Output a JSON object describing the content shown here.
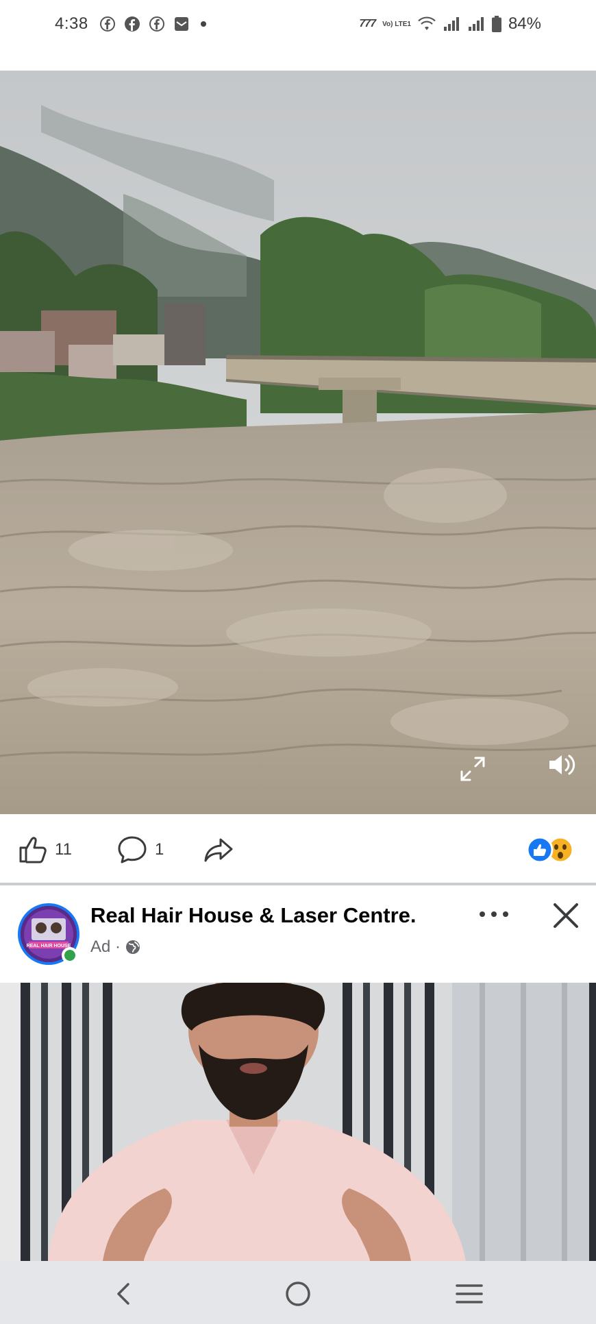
{
  "status_bar": {
    "time": "4:38",
    "network_label": "777",
    "volte_label": "Vo) LTE1",
    "battery": "84%"
  },
  "video": {
    "description_icon_expand": "expand-icon",
    "description_icon_sound": "speaker-icon"
  },
  "actions": {
    "like_count": "11",
    "comment_count": "1"
  },
  "ad": {
    "page_name": "Real Hair House & Laser Centre.",
    "label": "Ad ·",
    "logo_text": "REAL HAIR HOUSE"
  },
  "colors": {
    "facebook_blue": "#1877f2",
    "online_green": "#31a24c",
    "divider": "#c9ccd1",
    "nav_bg": "#e4e6ea"
  }
}
